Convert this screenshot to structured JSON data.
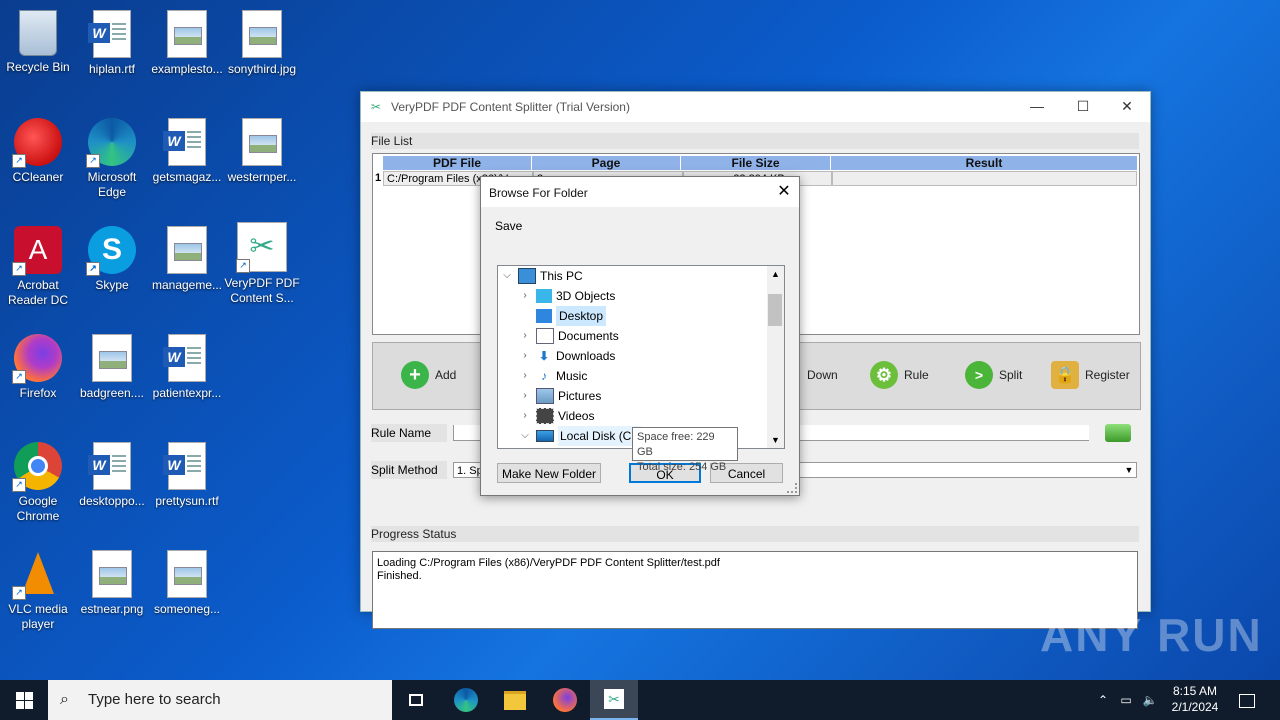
{
  "desktop": {
    "icons": [
      {
        "label": "Recycle Bin"
      },
      {
        "label": "hiplan.rtf"
      },
      {
        "label": "examplesto..."
      },
      {
        "label": "sonythird.jpg"
      },
      {
        "label": "CCleaner"
      },
      {
        "label": "Microsoft Edge"
      },
      {
        "label": "getsmagaz..."
      },
      {
        "label": "westernper..."
      },
      {
        "label": "Acrobat Reader DC"
      },
      {
        "label": "Skype"
      },
      {
        "label": "manageme..."
      },
      {
        "label": "VeryPDF PDF Content S..."
      },
      {
        "label": "Firefox"
      },
      {
        "label": "badgreen...."
      },
      {
        "label": "patientexpr..."
      },
      {
        "label": "Google Chrome"
      },
      {
        "label": "desktoppo..."
      },
      {
        "label": "prettysun.rtf"
      },
      {
        "label": "VLC media player"
      },
      {
        "label": "estnear.png"
      },
      {
        "label": "someoneg..."
      }
    ]
  },
  "app": {
    "title": "VeryPDF PDF Content Splitter (Trial Version)",
    "file_list_label": "File List",
    "columns": [
      "PDF File",
      "Page",
      "File Size",
      "Result"
    ],
    "row": {
      "index": "1",
      "file": "C:/Program Files (x86)/V...",
      "page": "2",
      "size": "32,804 KB",
      "result": ""
    },
    "toolbar": {
      "add": "Add",
      "down": "Down",
      "rule": "Rule",
      "split": "Split",
      "register": "Register"
    },
    "rule_name_label": "Rule Name",
    "rule_name_value": "",
    "split_method_label": "Split Method",
    "split_method_value": "1. Sp",
    "progress_label": "Progress Status",
    "log": [
      "Loading C:/Program Files (x86)/VeryPDF PDF Content Splitter/test.pdf",
      "Finished."
    ]
  },
  "dialog": {
    "title": "Browse For Folder",
    "prompt": "Save",
    "tree": [
      {
        "label": "This PC",
        "expanded": true
      },
      {
        "label": "3D Objects"
      },
      {
        "label": "Desktop",
        "selected": true
      },
      {
        "label": "Documents"
      },
      {
        "label": "Downloads"
      },
      {
        "label": "Music"
      },
      {
        "label": "Pictures"
      },
      {
        "label": "Videos"
      },
      {
        "label": "Local Disk (C:)",
        "expanded": true
      }
    ],
    "make_new_folder": "Make New Folder",
    "ok": "OK",
    "cancel": "Cancel",
    "tooltip": [
      "Space free: 229 GB",
      "Total size: 254 GB"
    ]
  },
  "taskbar": {
    "search_placeholder": "Type here to search",
    "time": "8:15 AM",
    "date": "2/1/2024"
  },
  "watermark": "ANY RUN"
}
